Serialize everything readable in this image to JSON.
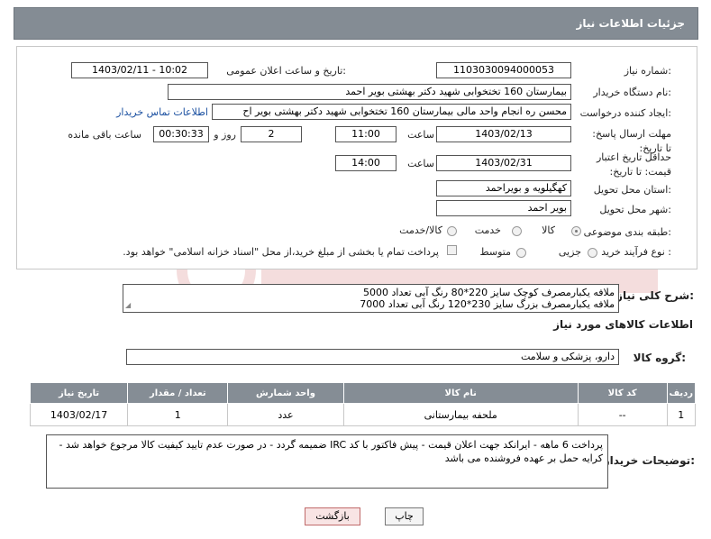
{
  "header": {
    "title": "جزئیات اطلاعات نیاز"
  },
  "form": {
    "need_number": {
      "label": "شماره نیاز:",
      "value": "1103030094000053"
    },
    "announce_datetime": {
      "label": "تاریخ و ساعت اعلان عمومی:",
      "value": "1403/02/11 - 10:02"
    },
    "buyer_org": {
      "label": "نام دستگاه خریدار:",
      "value": "بیمارستان 160 تختخوابی شهید دکتر بهشتی بویر احمد"
    },
    "requester": {
      "label": "ایجاد کننده درخواست:",
      "value": "محسن ره انجام واحد مالی بیمارستان 160 تختخوابی شهید دکتر بهشتی بویر اح",
      "link": "اطلاعات تماس خریدار"
    },
    "deadline": {
      "label": "مهلت ارسال پاسخ: تا تاریخ:",
      "date": "1403/02/13",
      "time_label": "ساعت",
      "time": "11:00",
      "days": "2",
      "days_label": "روز و",
      "remaining": "00:30:33",
      "remaining_label": "ساعت باقی مانده"
    },
    "min_validity": {
      "label": "حداقل تاریخ اعتبار قیمت: تا تاریخ:",
      "date": "1403/02/31",
      "time_label": "ساعت",
      "time": "14:00"
    },
    "province": {
      "label": "استان محل تحویل:",
      "value": "کهگیلویه و بویراحمد"
    },
    "city": {
      "label": "شهر محل تحویل:",
      "value": "بویر احمد"
    },
    "category": {
      "label": "طبقه بندی موضوعی:",
      "options": [
        "کالا",
        "خدمت",
        "کالا/خدمت"
      ],
      "selected": "کالا"
    },
    "purchase_type": {
      "label": "نوع فرآیند خرید :",
      "options": [
        "جزیی",
        "متوسط"
      ],
      "selected": "",
      "note": "پرداخت تمام یا بخشی از مبلغ خرید،از محل \"اسناد خزانه اسلامی\" خواهد بود."
    }
  },
  "description": {
    "label": "شرح کلی نیاز:",
    "lines": [
      "ملافه یکبارمصرف کوچک سایز 220*80 رنگ آبی تعداد 5000",
      "ملافه یکبارمصرف بزرگ سایز 230*120 رنگ آبی تعداد 7000"
    ]
  },
  "goods_info": {
    "title": "اطلاعات کالاهای مورد نیاز"
  },
  "goods_group": {
    "label": "گروه کالا:",
    "value": "دارو، پزشکی و سلامت"
  },
  "table": {
    "headers": [
      "ردیف",
      "کد کالا",
      "نام کالا",
      "واحد شمارش",
      "تعداد / مقدار",
      "تاریخ نیاز"
    ],
    "rows": [
      [
        "1",
        "--",
        "ملحفه بیمارستانی",
        "عدد",
        "1",
        "1403/02/17"
      ]
    ]
  },
  "buyer_notes": {
    "label": "توضیحات خریدار:",
    "text": "پرداخت 6 ماهه - ایرانکد جهت اعلان قیمت - پیش فاکتور با کد IRC ضمیمه گردد - در صورت عدم تایید کیفیت کالا مرجوع خواهد شد - کرایه حمل بر عهده فروشنده می باشد"
  },
  "buttons": {
    "print": "چاپ",
    "back": "بازگشت"
  },
  "colors": {
    "header_bg": "#848c94",
    "table_header_bg": "#858d95",
    "link": "#1a4fa0",
    "back_btn_bg": "#f8e4e4"
  }
}
